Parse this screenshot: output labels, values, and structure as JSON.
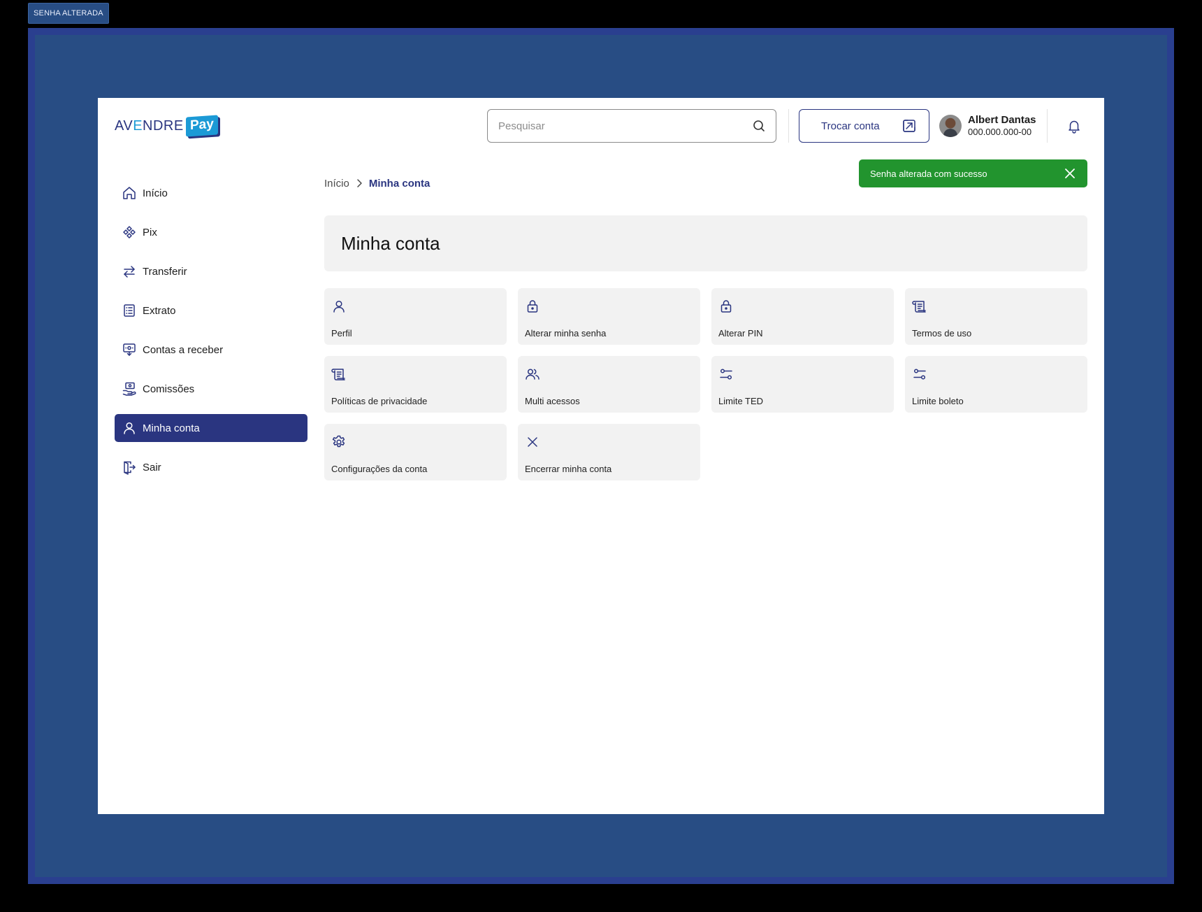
{
  "frame_label": "SENHA ALTERADA",
  "header": {
    "logo_main": "AV",
    "logo_e": "E",
    "logo_rest": "NDRE",
    "logo_pay": "Pay",
    "search_placeholder": "Pesquisar",
    "switch_account_label": "Trocar conta",
    "user_name": "Albert Dantas",
    "user_document": "000.000.000-00"
  },
  "toast": {
    "message": "Senha alterada com sucesso",
    "color": "#22942e"
  },
  "sidebar": {
    "items": [
      {
        "label": "Início",
        "icon": "home-icon"
      },
      {
        "label": "Pix",
        "icon": "pix-icon"
      },
      {
        "label": "Transferir",
        "icon": "transfer-arrows-icon"
      },
      {
        "label": "Extrato",
        "icon": "statement-icon"
      },
      {
        "label": "Contas a receber",
        "icon": "receivables-icon"
      },
      {
        "label": "Comissões",
        "icon": "commission-icon"
      },
      {
        "label": "Minha conta",
        "icon": "user-icon",
        "active": true
      },
      {
        "label": "Sair",
        "icon": "logout-icon"
      }
    ]
  },
  "breadcrumb": {
    "home": "Início",
    "current": "Minha conta"
  },
  "page_title": "Minha conta",
  "options": [
    {
      "label": "Perfil",
      "icon": "user-icon"
    },
    {
      "label": "Alterar minha senha",
      "icon": "lock-icon"
    },
    {
      "label": "Alterar PIN",
      "icon": "lock-icon"
    },
    {
      "label": "Termos de uso",
      "icon": "scroll-icon"
    },
    {
      "label": "Políticas de privacidade",
      "icon": "scroll-icon"
    },
    {
      "label": "Multi acessos",
      "icon": "users-icon"
    },
    {
      "label": "Limite TED",
      "icon": "sliders-icon"
    },
    {
      "label": "Limite boleto",
      "icon": "sliders-icon"
    },
    {
      "label": "Configurações da conta",
      "icon": "gear-icon"
    },
    {
      "label": "Encerrar minha conta",
      "icon": "close-icon"
    }
  ],
  "colors": {
    "brand": "#2a3580",
    "accent": "#1c9ad6",
    "success": "#22942e",
    "outer_frame": "#2a3f8f",
    "outer_background": "#284d84"
  }
}
